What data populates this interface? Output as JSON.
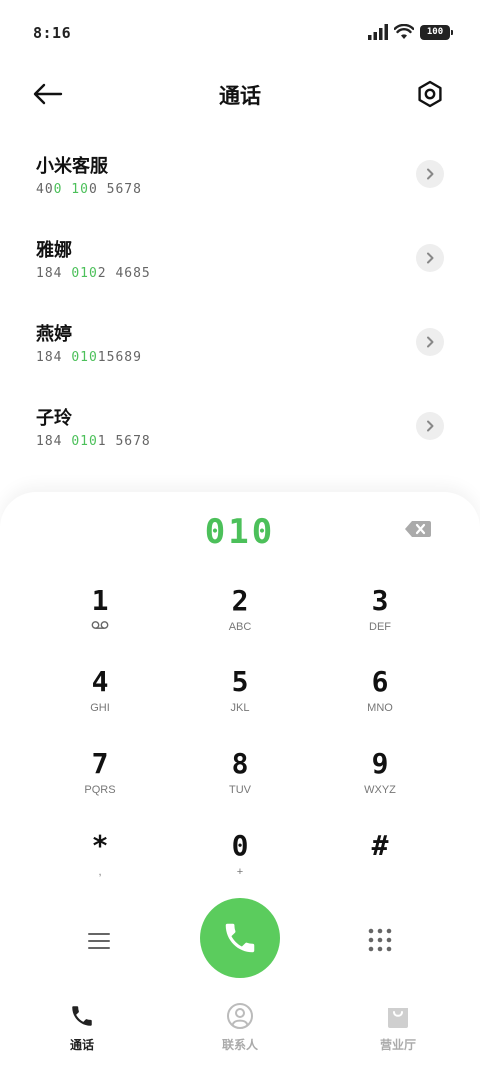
{
  "status_bar": {
    "time": "8:16",
    "battery": "100"
  },
  "header": {
    "title": "通话"
  },
  "contacts": [
    {
      "name": "小米客服",
      "number_parts": [
        "40",
        "0 10",
        "0 5678"
      ]
    },
    {
      "name": "雅娜",
      "number_parts": [
        "184 ",
        "010",
        "2 4685"
      ]
    },
    {
      "name": "燕婷",
      "number_parts": [
        "184 ",
        "010",
        "15689"
      ]
    },
    {
      "name": "子玲",
      "number_parts": [
        "184 ",
        "010",
        "1 5678"
      ]
    }
  ],
  "dialer": {
    "display": "010",
    "keys": [
      {
        "digit": "1",
        "letters": ""
      },
      {
        "digit": "2",
        "letters": "ABC"
      },
      {
        "digit": "3",
        "letters": "DEF"
      },
      {
        "digit": "4",
        "letters": "GHI"
      },
      {
        "digit": "5",
        "letters": "JKL"
      },
      {
        "digit": "6",
        "letters": "MNO"
      },
      {
        "digit": "7",
        "letters": "PQRS"
      },
      {
        "digit": "8",
        "letters": "TUV"
      },
      {
        "digit": "9",
        "letters": "WXYZ"
      },
      {
        "digit": "*",
        "letters": ","
      },
      {
        "digit": "0",
        "letters": "+"
      },
      {
        "digit": "#",
        "letters": ""
      }
    ]
  },
  "bottom_nav": [
    {
      "label": "通话",
      "icon": "phone-icon",
      "active": true
    },
    {
      "label": "联系人",
      "icon": "person-icon",
      "active": false
    },
    {
      "label": "营业厅",
      "icon": "shopping-bag-icon",
      "active": false
    }
  ],
  "colors": {
    "accent": "#4cc05a",
    "call_button": "#5bcc5d"
  }
}
